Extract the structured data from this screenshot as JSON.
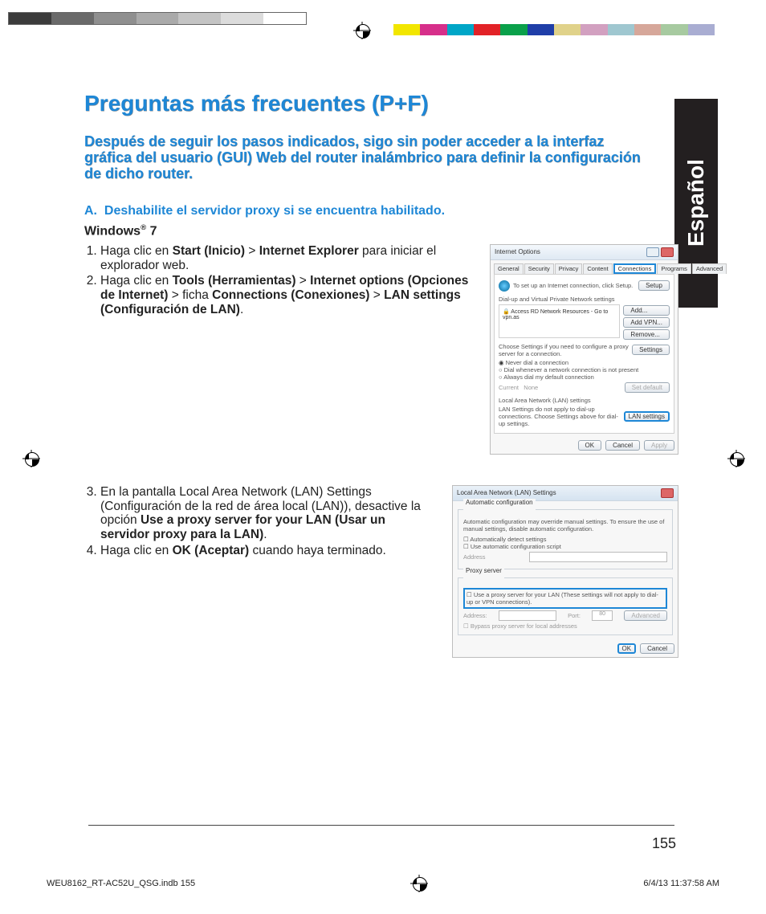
{
  "colorbar_left": [
    "#3b3b3b",
    "#6a6a6a",
    "#8f8f8f",
    "#aaaaaa",
    "#c4c4c4",
    "#dcdcdc",
    "#ffffff"
  ],
  "colorbar_right": [
    "#f2e600",
    "#d62f8a",
    "#00a6c7",
    "#e22227",
    "#0aa04a",
    "#1f3ea8",
    "#e0d28a",
    "#d2a0c0",
    "#9fc7d0",
    "#d6a79a",
    "#a7caa0",
    "#a9add2"
  ],
  "title": "Preguntas más frecuentes (P+F)",
  "question": "Después de seguir los pasos indicados, sigo sin poder acceder a la interfaz gráfica del usuario (GUI) Web del router inalámbrico para definir la configuración de dicho router.",
  "sectionA_prefix": "A.",
  "sectionA_text": "Deshabilite el servidor proxy si se encuentra habilitado.",
  "os_label_prefix": "Windows",
  "os_label_suffix": "7",
  "steps_block1": [
    {
      "pre": "Haga clic en ",
      "b1": "Start (Inicio)",
      "mid1": " > ",
      "b2": "Internet Explorer",
      "post": " para iniciar el explorador web."
    },
    {
      "pre": "Haga clic en ",
      "b1": "Tools (Herramientas)",
      "mid1": " > ",
      "b2": "Internet options (Opciones de Internet)",
      "mid2": " > ficha ",
      "b3": "Connections (Conexiones)",
      "mid3": " > ",
      "b4": "LAN settings (Configuración de LAN)",
      "post": "."
    }
  ],
  "steps_block2": [
    {
      "pre": "En la pantalla Local Area Network (LAN) Settings (Configuración de la red de área local (LAN)), desactive la opción ",
      "b1": "Use a proxy server for your LAN (Usar un",
      "br": true,
      "b2": "servidor proxy para la LAN)",
      "post": "."
    },
    {
      "pre": "Haga clic en ",
      "b1": "OK (Aceptar)",
      "post": " cuando haya terminado."
    }
  ],
  "dlg1": {
    "title": "Internet Options",
    "tabs": [
      "General",
      "Security",
      "Privacy",
      "Content",
      "Connections",
      "Programs",
      "Advanced"
    ],
    "active_tab": "Connections",
    "setup_text": "To set up an Internet connection, click Setup.",
    "setup_btn": "Setup",
    "vpn_heading": "Dial-up and Virtual Private Network settings",
    "vpn_item": "Access RD Network Resources - Go to vpn.as",
    "btn_add": "Add...",
    "btn_addvpn": "Add VPN...",
    "btn_remove": "Remove...",
    "choose_text": "Choose Settings if you need to configure a proxy server for a connection.",
    "btn_settings": "Settings",
    "r1": "Never dial a connection",
    "r2": "Dial whenever a network connection is not present",
    "r3": "Always dial my default connection",
    "current": "Current",
    "none": "None",
    "setdef": "Set default",
    "lan_heading": "Local Area Network (LAN) settings",
    "lan_text": "LAN Settings do not apply to dial-up connections. Choose Settings above for dial-up settings.",
    "btn_lan": "LAN settings",
    "ok": "OK",
    "cancel": "Cancel",
    "apply": "Apply"
  },
  "dlg2": {
    "title": "Local Area Network (LAN) Settings",
    "auto_heading": "Automatic configuration",
    "auto_text": "Automatic configuration may override manual settings. To ensure the use of manual settings, disable automatic configuration.",
    "c1": "Automatically detect settings",
    "c2": "Use automatic configuration script",
    "addr": "Address",
    "proxy_heading": "Proxy server",
    "proxy_text": "Use a proxy server for your LAN (These settings will not apply to dial-up or VPN connections).",
    "addr2": "Address:",
    "port": "Port:",
    "port_val": "80",
    "adv": "Advanced",
    "bypass": "Bypass proxy server for local addresses",
    "ok": "OK",
    "cancel": "Cancel"
  },
  "side_tab": "Español",
  "page_num": "155",
  "footer_left": "WEU8162_RT-AC52U_QSG.indb   155",
  "footer_right": "6/4/13   11:37:58 AM"
}
